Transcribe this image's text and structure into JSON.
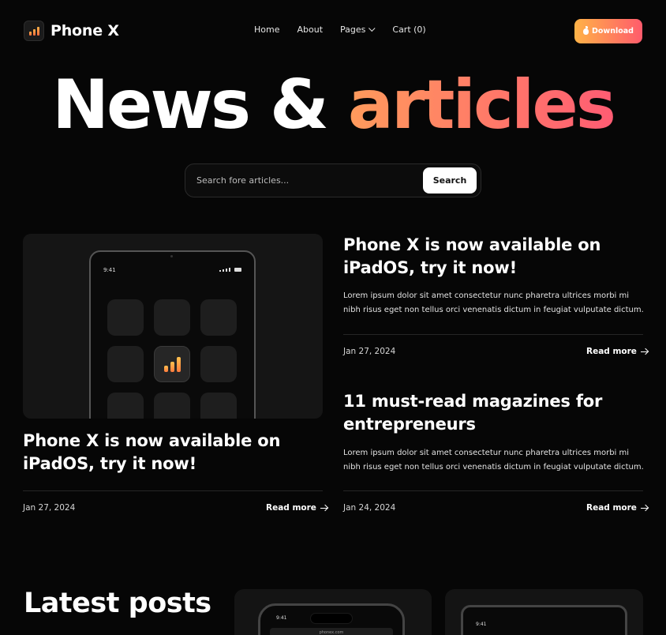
{
  "brand": {
    "name": "Phone X"
  },
  "nav": {
    "items": [
      {
        "label": "Home"
      },
      {
        "label": "About"
      },
      {
        "label": "Pages"
      },
      {
        "label": "Cart (0)"
      }
    ],
    "download_label": "Download"
  },
  "hero": {
    "title_part1": "News &",
    "title_part2": "articles",
    "search_placeholder": "Search fore articles...",
    "search_button": "Search"
  },
  "featured": {
    "title": "Phone X is now available on iPadOS, try it now!",
    "date": "Jan 27, 2024",
    "read_more": "Read more",
    "device_time": "9:41"
  },
  "articles": [
    {
      "title": "Phone X is now available on iPadOS, try it now!",
      "description": "Lorem ipsum dolor sit amet consectetur nunc pharetra ultrices morbi mi nibh risus eget non tellus orci venenatis dictum in feugiat vulputate dictum.",
      "date": "Jan 27, 2024",
      "read_more": "Read more"
    },
    {
      "title": "11 must-read magazines for entrepreneurs",
      "description": "Lorem ipsum dolor sit amet consectetur nunc pharetra ultrices morbi mi nibh risus eget non tellus orci venenatis dictum in feugiat vulputate dictum.",
      "date": "Jan 24, 2024",
      "read_more": "Read more"
    }
  ],
  "latest": {
    "title": "Latest posts",
    "cards": [
      {
        "device_time": "9:41",
        "url": "phonex.com"
      },
      {
        "device_time": "9:41"
      }
    ]
  },
  "colors": {
    "background": "#060606",
    "accent_start": "#ffb347",
    "accent_end": "#ff5b6c"
  }
}
